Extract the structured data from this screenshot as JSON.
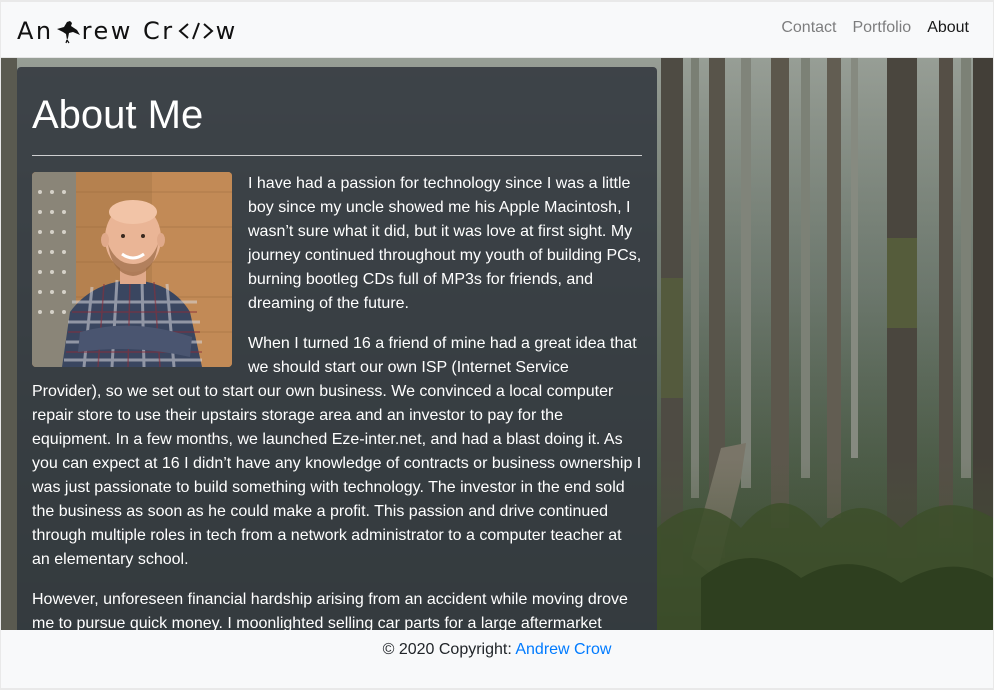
{
  "brand": {
    "part1": "An",
    "part2": "rew Cr",
    "part3": "w"
  },
  "nav": {
    "items": [
      {
        "label": "Contact",
        "active": false
      },
      {
        "label": "Portfolio",
        "active": false
      },
      {
        "label": "About",
        "active": true
      }
    ]
  },
  "main": {
    "title": "About Me",
    "paragraphs": [
      "I have had a passion for technology since I was a little boy since my uncle showed me his Apple Macintosh, I wasn’t sure what it did, but it was love at first sight. My journey continued throughout my youth of building PCs, burning bootleg CDs full of MP3s for friends, and dreaming of the future.",
      "When I turned 16 a friend of mine had a great idea that we should start our own ISP (Internet Service Provider), so we set out to start our own business. We convinced a local computer repair store to use their upstairs storage area and an investor to pay for the equipment. In a few months, we launched Eze-inter.net, and had a blast doing it. As you can expect at 16 I didn’t have any knowledge of contracts or business ownership I was just passionate to build something with technology. The investor in the end sold the business as soon as he could make a profit. This passion and drive continued through multiple roles in tech from a network administrator to a computer teacher at an elementary school.",
      "However, unforeseen financial hardship arising from an accident while moving drove me to pursue quick money. I moonlighted selling car parts for a large aftermarket"
    ]
  },
  "footer": {
    "copyright": "© 2020 Copyright: ",
    "link_label": "Andrew Crow"
  },
  "colors": {
    "link": "#007bff",
    "panel": "#343a40"
  }
}
